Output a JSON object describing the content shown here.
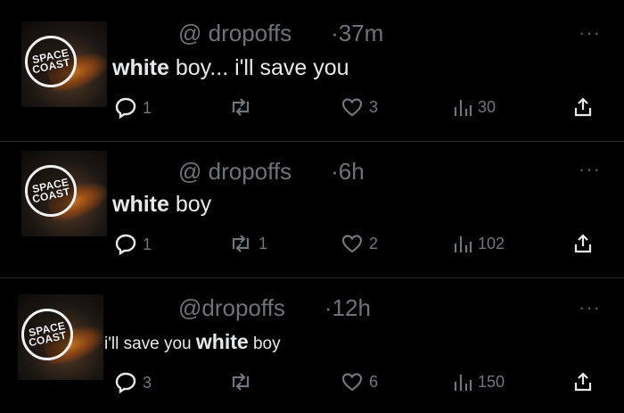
{
  "tweets": [
    {
      "handle": "@ dropoffs",
      "time": "·37m",
      "more": "···",
      "text": [
        {
          "w": "white",
          "bold": true
        },
        {
          "w": " boy... i'll save you",
          "bold": false
        }
      ],
      "replies": "1",
      "retweets": "",
      "likes": "3",
      "views": "30"
    },
    {
      "handle": "@ dropoffs",
      "time": "·6h",
      "more": "···",
      "text": [
        {
          "w": "white",
          "bold": true
        },
        {
          "w": " boy",
          "bold": false
        }
      ],
      "replies": "1",
      "retweets": "1",
      "likes": "2",
      "views": "102"
    },
    {
      "handle": "@dropoffs",
      "time": "·12h",
      "more": "···",
      "text": [
        {
          "w": "i'll save you ",
          "bold": false
        },
        {
          "w": "white",
          "bold": true
        },
        {
          "w": " boy",
          "bold": false
        }
      ],
      "replies": "3",
      "retweets": "",
      "likes": "6",
      "views": "150"
    }
  ],
  "avatar_text": {
    "line1": "SPACE",
    "line2": "COAST"
  },
  "colors": {
    "background": "#000000",
    "text": "#e7e9ea",
    "muted": "#71767b"
  }
}
